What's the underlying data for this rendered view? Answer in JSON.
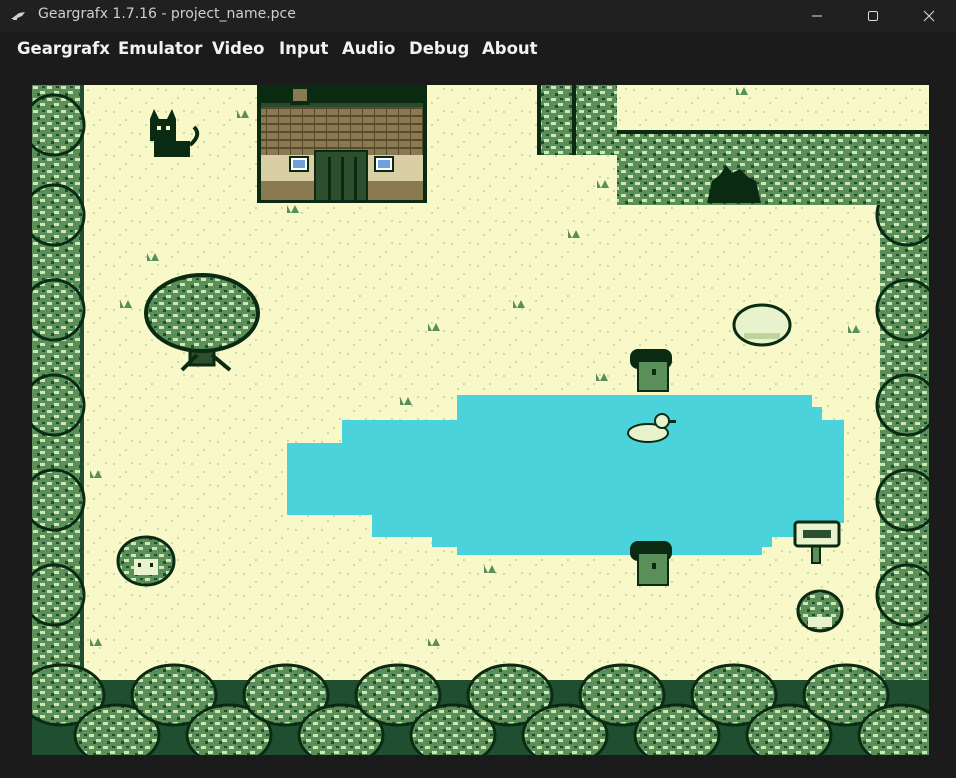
{
  "window": {
    "title": "Geargrafx 1.7.16 - project_name.pce",
    "icon": "geargrafx-app-icon",
    "controls": [
      "minimize-icon",
      "maximize-icon",
      "close-icon"
    ]
  },
  "menu": {
    "items": [
      {
        "label": "Geargrafx"
      },
      {
        "label": "Emulator"
      },
      {
        "label": "Video"
      },
      {
        "label": "Input"
      },
      {
        "label": "Audio"
      },
      {
        "label": "Debug"
      },
      {
        "label": "About"
      }
    ]
  },
  "game": {
    "palette": {
      "light": "#f9f8c8",
      "speck": "#bdd49a",
      "leaf_light": "#cfe6b4",
      "leaf_mid": "#5a8f5a",
      "leaf_dark": "#1f4f30",
      "darkest": "#0b2a12",
      "water": "#4ad3da",
      "roof": "#7a6a4a"
    },
    "sprites": [
      "cat",
      "house",
      "tree",
      "boulder",
      "cave-entrance",
      "pond",
      "duck",
      "villager-top",
      "villager-bottom",
      "girl",
      "slime",
      "signpost",
      "tree-border"
    ]
  }
}
